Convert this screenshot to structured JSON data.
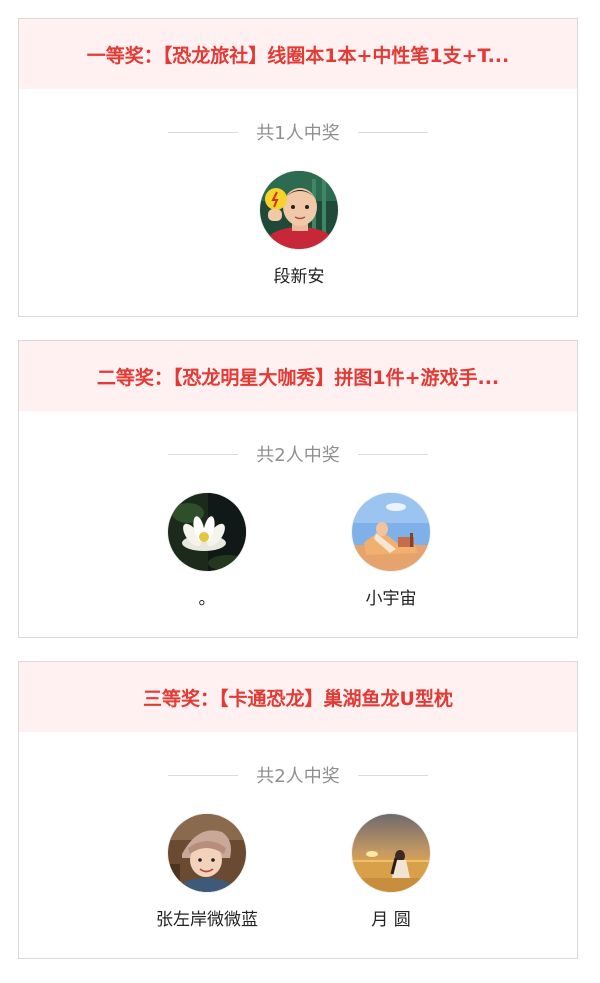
{
  "prizes": [
    {
      "title": "一等奖：【恐龙旅社】线圈本1本+中性笔1支+T...",
      "count_text": "共1人中奖",
      "winners": [
        {
          "name": "段新安",
          "avatar": "avatar-boy-photo"
        }
      ]
    },
    {
      "title": "二等奖：【恐龙明星大咖秀】拼图1件+游戏手...",
      "count_text": "共2人中奖",
      "winners": [
        {
          "name": "。",
          "avatar": "avatar-lotus-photo"
        },
        {
          "name": "小宇宙",
          "avatar": "avatar-beach-photo"
        }
      ]
    },
    {
      "title": "三等奖：【卡通恐龙】巢湖鱼龙U型枕",
      "count_text": "共2人中奖",
      "winners": [
        {
          "name": "张左岸微微蓝",
          "avatar": "avatar-girl-photo"
        },
        {
          "name": "月 圆",
          "avatar": "avatar-sunset-photo"
        }
      ]
    }
  ],
  "colors": {
    "header_bg": "#fff1f1",
    "header_text": "#e23b35",
    "count_text": "#8f8f8f",
    "border": "#d9d9d9"
  }
}
